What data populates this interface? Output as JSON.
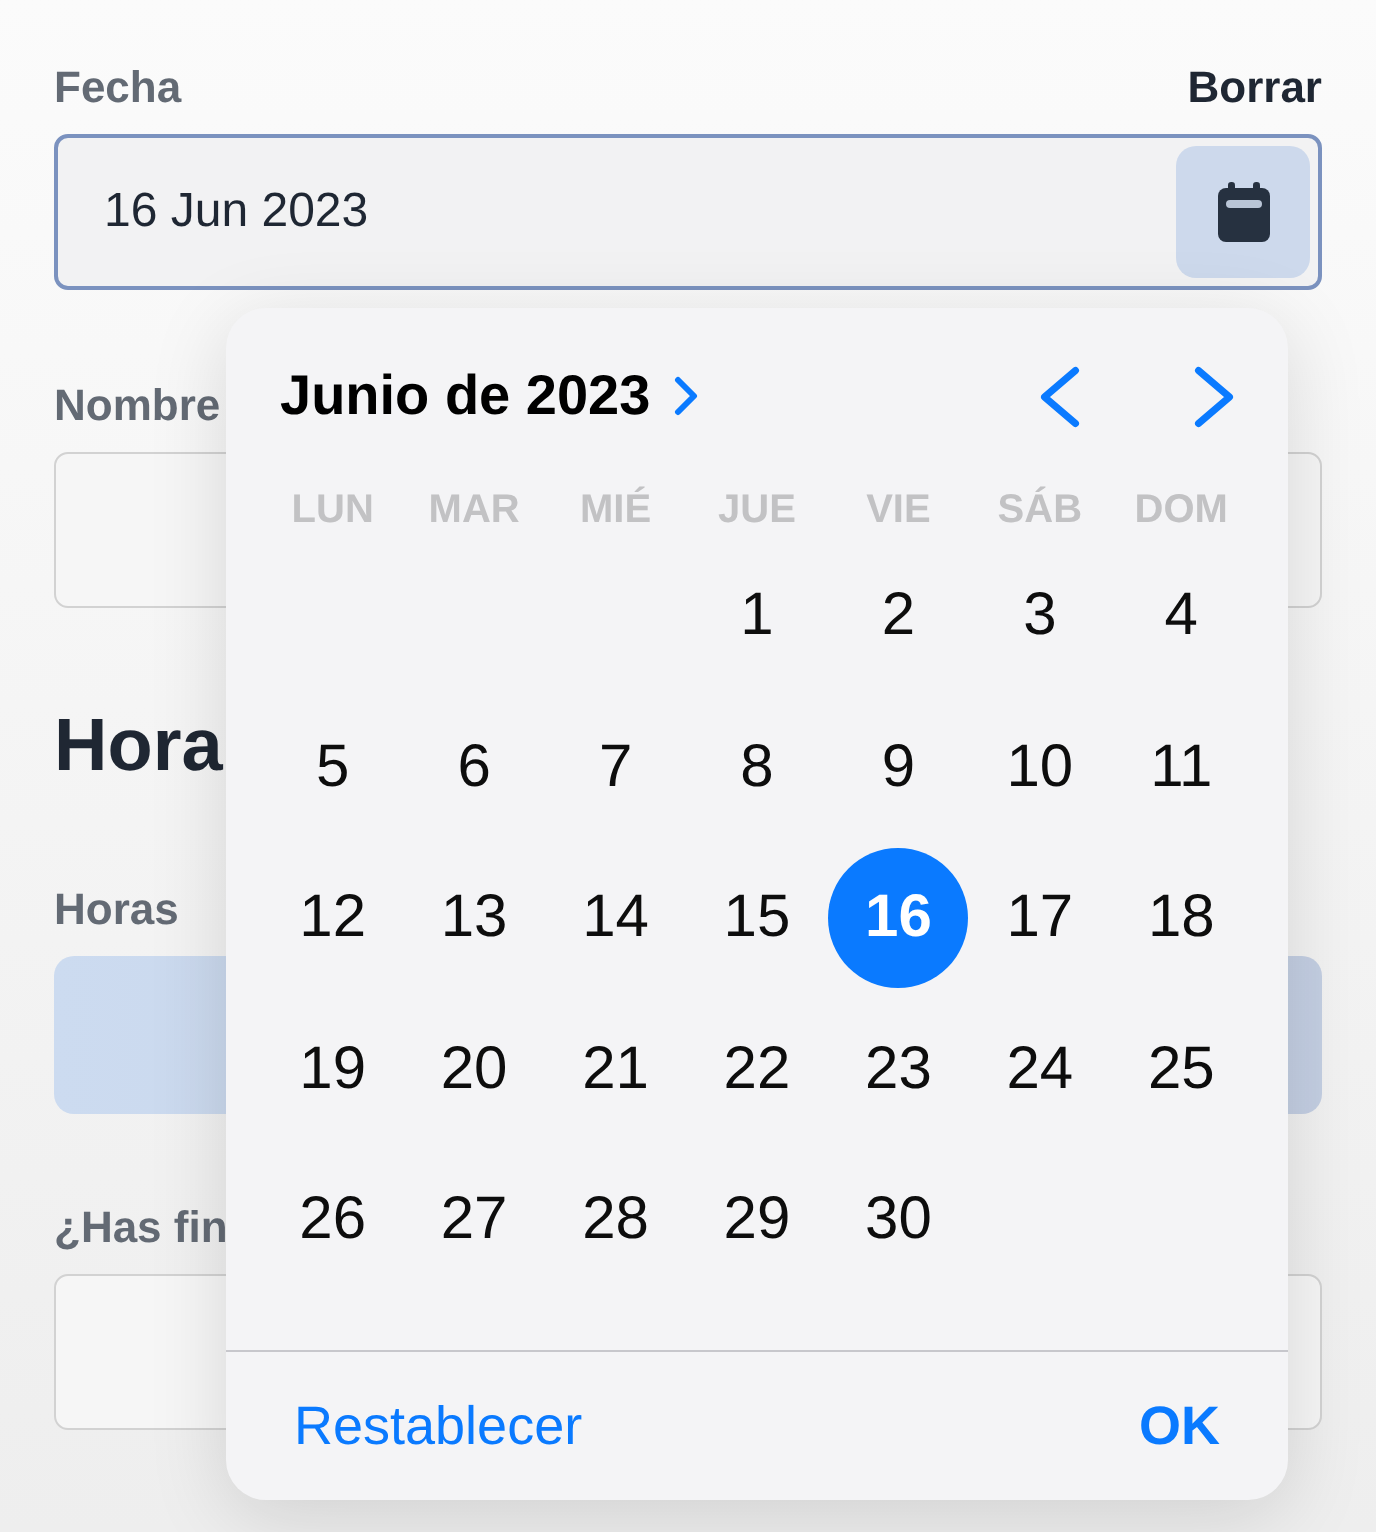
{
  "form": {
    "fields": [
      {
        "kind": "date",
        "label": "Fecha",
        "clear_link": "Borrar",
        "value": "16 Jun 2023",
        "focused": true
      },
      {
        "kind": "text",
        "label": "Nombre",
        "focused": false
      }
    ],
    "section": {
      "heading": "Hora",
      "fields": [
        {
          "kind": "picker",
          "label": "Horas"
        },
        {
          "kind": "text",
          "label": "¿Has fin",
          "focused": false
        }
      ]
    }
  },
  "date_picker": {
    "month_title": "Junio de 2023",
    "weekdays": [
      "LUN",
      "MAR",
      "MIÉ",
      "JUE",
      "VIE",
      "SÁB",
      "DOM"
    ],
    "weeks": [
      {
        "days": [
          {
            "label": "1",
            "selected": false
          },
          {
            "label": "2",
            "selected": false
          },
          {
            "label": "3",
            "selected": false
          },
          {
            "label": "4",
            "selected": false
          }
        ]
      },
      {
        "days": [
          {
            "label": "5",
            "selected": false
          },
          {
            "label": "6",
            "selected": false
          },
          {
            "label": "7",
            "selected": false
          },
          {
            "label": "8",
            "selected": false
          },
          {
            "label": "9",
            "selected": false
          },
          {
            "label": "10",
            "selected": false
          },
          {
            "label": "11",
            "selected": false
          }
        ]
      },
      {
        "days": [
          {
            "label": "12",
            "selected": false
          },
          {
            "label": "13",
            "selected": false
          },
          {
            "label": "14",
            "selected": false
          },
          {
            "label": "15",
            "selected": false
          },
          {
            "label": "16",
            "selected": true
          },
          {
            "label": "17",
            "selected": false
          },
          {
            "label": "18",
            "selected": false
          }
        ]
      },
      {
        "days": [
          {
            "label": "19",
            "selected": false
          },
          {
            "label": "20",
            "selected": false
          },
          {
            "label": "21",
            "selected": false
          },
          {
            "label": "22",
            "selected": false
          },
          {
            "label": "23",
            "selected": false
          },
          {
            "label": "24",
            "selected": false
          },
          {
            "label": "25",
            "selected": false
          }
        ]
      },
      {
        "days": [
          {
            "label": "26",
            "selected": false
          },
          {
            "label": "27",
            "selected": false
          },
          {
            "label": "28",
            "selected": false
          },
          {
            "label": "29",
            "selected": false
          },
          {
            "label": "30",
            "selected": false
          }
        ]
      }
    ],
    "reset_button": "Restablecer",
    "ok_button": "OK"
  }
}
